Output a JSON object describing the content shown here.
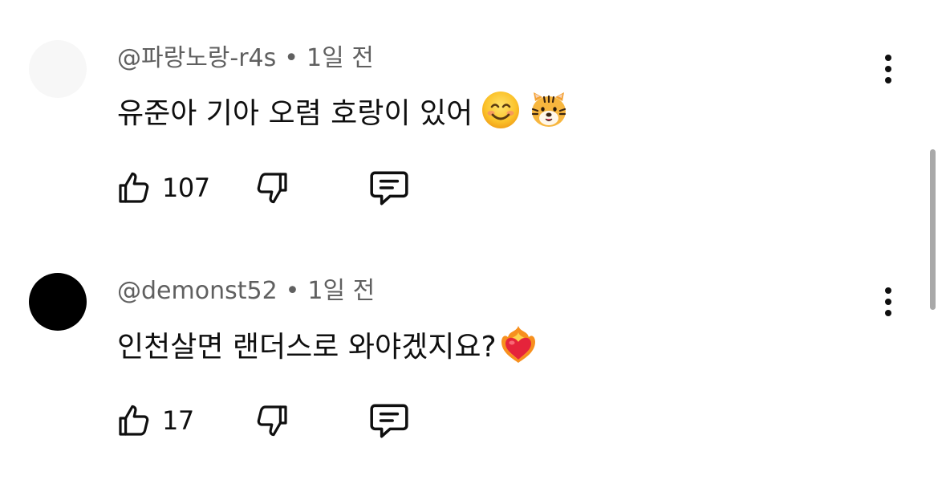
{
  "comments": [
    {
      "author": "@파랑노랑-r4s",
      "separator": "•",
      "time": "1일 전",
      "text": "유준아 기아 오렴 호랑이 있어",
      "emojis": [
        "smiling-face-icon",
        "tiger-face-icon"
      ],
      "likes": "107",
      "avatar_color": "#f7f7f7"
    },
    {
      "author": "@demonst52",
      "separator": "•",
      "time": "1일 전",
      "text": "인천살면 랜더스로 와야겠지요?",
      "emojis": [
        "heart-on-fire-icon"
      ],
      "likes": "17",
      "avatar_color": "#000000"
    }
  ],
  "colors": {
    "text_primary": "#0f0f0f",
    "text_secondary": "#606060",
    "scrollbar": "#a9a9a9"
  }
}
